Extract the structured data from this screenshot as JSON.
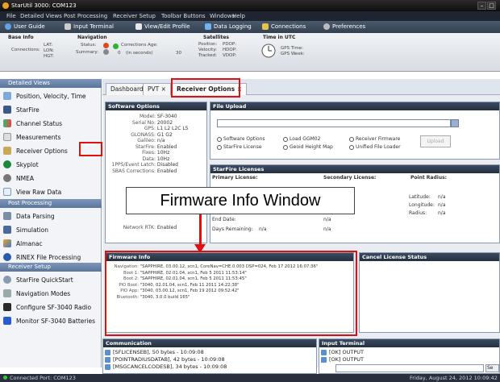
{
  "window": {
    "title": "StarUtil 3000: COM123"
  },
  "menu": [
    "File",
    "Detailed Views",
    "Post Processing",
    "Receiver Setup",
    "Toolbar Buttons",
    "Windows",
    "Help"
  ],
  "toolbar": [
    {
      "label": "User Guide",
      "icon": "help-icon"
    },
    {
      "label": "Input Terminal",
      "icon": "terminal-icon"
    },
    {
      "label": "View/Edit Profile",
      "icon": "profile-icon"
    },
    {
      "label": "Data Logging",
      "icon": "logging-icon"
    },
    {
      "label": "Connections",
      "icon": "connections-icon"
    },
    {
      "label": "Preferences",
      "icon": "gear-icon"
    }
  ],
  "status_strip": {
    "base_info": {
      "title": "Base Info",
      "connections": "Connections:",
      "lat": "LAT:",
      "lon": "LON:",
      "hgt": "HGT:"
    },
    "navigation": {
      "title": "Navigation",
      "status": "Status:",
      "summary": "Summary:",
      "conn_age": "Corrections Age:",
      "age_value": "0",
      "age_unit": "(in seconds)",
      "age_max": "30"
    },
    "satellites": {
      "title": "Satellites",
      "position": "Position:",
      "velocity": "Velocity:",
      "tracked": "Tracked:",
      "pdop": "PDOP:",
      "hdop": "HDOP:",
      "vdop": "VDOP:"
    },
    "time": {
      "title": "Time in UTC",
      "gps_time": "GPS Time:",
      "gps_week": "GPS Week:"
    }
  },
  "sidebar": {
    "detailed_header": "Detailed Views",
    "detailed_items": [
      "Position, Velocity, Time",
      "StarFire",
      "Channel Status",
      "Measurements",
      "Receiver Options",
      "Skyplot",
      "NMEA",
      "View Raw Data"
    ],
    "post_header": "Post Processing",
    "post_items": [
      "Data Parsing",
      "Simulation",
      "Almanac",
      "RINEX File Processing"
    ],
    "setup_header": "Receiver Setup",
    "setup_items": [
      "StarFire QuickStart",
      "Navigation Modes",
      "Configure SF-3040 Radio",
      "Monitor SF-3040 Batteries"
    ]
  },
  "tabs": [
    "Dashboard",
    "PVT",
    "Receiver Options"
  ],
  "software_options": {
    "title": "Software Options",
    "rows": [
      {
        "label": "Model:",
        "value": "SF-3040"
      },
      {
        "label": "Serial No:",
        "value": "20002"
      },
      {
        "label": "GPS:",
        "value": "L1 L2 L2C L5"
      },
      {
        "label": "GLONASS:",
        "value": "G1 G2"
      },
      {
        "label": "Galileo:",
        "value": "n/a"
      },
      {
        "label": "StarFire:",
        "value": "Enabled"
      },
      {
        "label": "Fixes:",
        "value": "10Hz"
      },
      {
        "label": "Data:",
        "value": "10Hz"
      },
      {
        "label": "1PPS/Event Latch:",
        "value": "Disabled"
      },
      {
        "label": "SBAS Corrections:",
        "value": "Enabled"
      }
    ],
    "network_rtk": {
      "label": "Network RTK:",
      "value": "Enabled"
    }
  },
  "file_upload": {
    "title": "File Upload",
    "options": [
      "Software Options",
      "Load GGM02",
      "Receiver Firmware",
      "StarFire License",
      "Geoid Height Map",
      "Unified File Loader"
    ],
    "upload_label": "Upload"
  },
  "starfire_licenses": {
    "title": "StarFire Licenses",
    "primary": "Primary License:",
    "secondary": "Secondary License:",
    "point": "Point Radius:",
    "latitude": "Latitude:",
    "longitude": "Longitude:",
    "radius": "Radius:",
    "na": "n/a",
    "end_date": "End Date:",
    "days_remaining": "Days Remaining:"
  },
  "callout": "Firmware Info Window",
  "firmware_info": {
    "title": "Firmware Info",
    "rows": [
      {
        "label": "Navigation:",
        "value": "\"SAPPHIRE, 03.00.12, scn1, CoreNav=CHE.0.003 DSP=024, Feb 17 2012 16:07:36\""
      },
      {
        "label": "Boot 1:",
        "value": "\"SAPPHIRE, 02.01.04, scn1, Feb 5 2011 11:53:14\""
      },
      {
        "label": "Boot 2:",
        "value": "\"SAPPHIRE, 02.01.04, scn1, Feb 5 2011 11:53:45\""
      },
      {
        "label": "PIO Boot:",
        "value": "\"3040, 02.01.04, scn1, Feb 11 2011 14:22:38\""
      },
      {
        "label": "PIO App:",
        "value": "\"3040, 03.00.12, scn1, Feb 19 2012 09:52:42\""
      },
      {
        "label": "Bluetooth:",
        "value": "\"3040, 3.0.0 build 165\""
      }
    ]
  },
  "cancel_license": {
    "title": "Cancel License Status"
  },
  "communication": {
    "title": "Communication",
    "lines": [
      "[SFLICENSEB], 50 bytes - 10:09:08",
      "[POINTRADIUSDATAB], 42 bytes - 10:09:08",
      "[MSGCANCELCODESB], 34 bytes - 10:09:08"
    ]
  },
  "input_terminal": {
    "title": "Input Terminal",
    "lines": [
      "[OK] OUTPUT",
      "[OK] OUTPUT"
    ],
    "send_label": "Se"
  },
  "statusbar": {
    "left": "Connected Port: COM123",
    "right": "Friday, August 24, 2012 10:09:42"
  }
}
